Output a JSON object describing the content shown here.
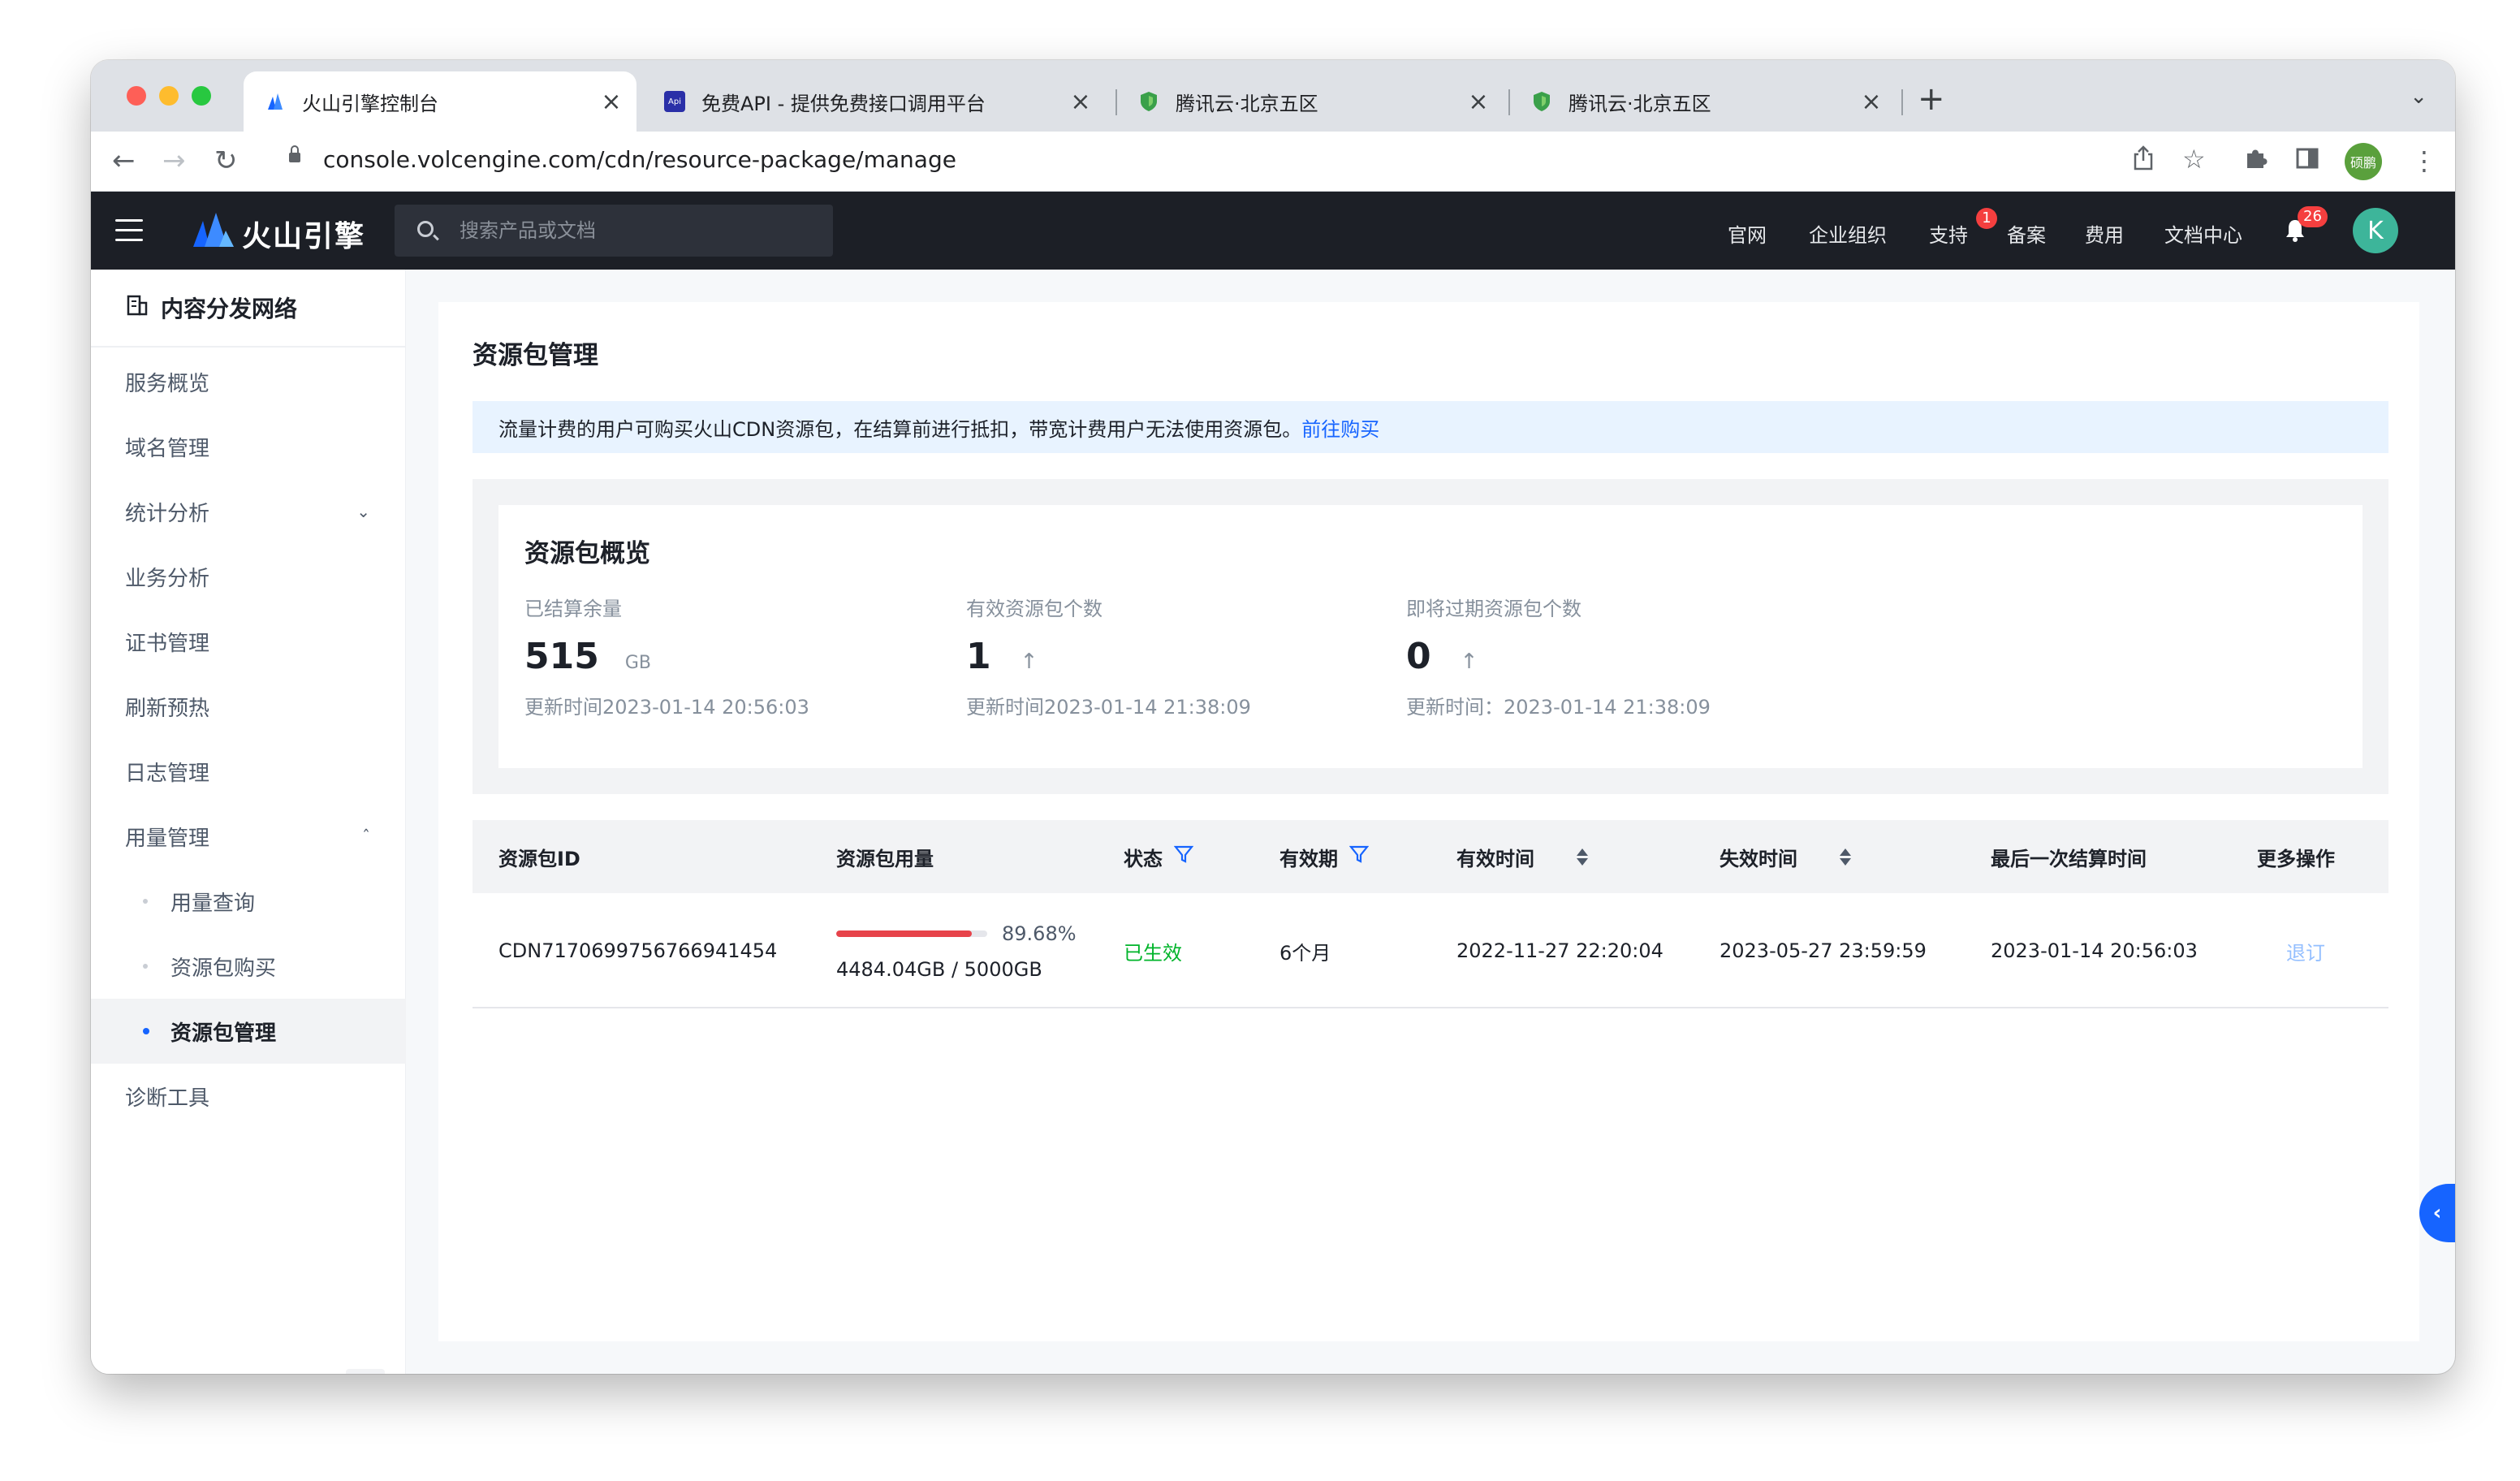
{
  "browser": {
    "tabs": [
      {
        "title": "火山引擎控制台",
        "active": true,
        "favicon": "volcengine-icon"
      },
      {
        "title": "免费API - 提供免费接口调用平台",
        "active": false,
        "favicon": "api-icon"
      },
      {
        "title": "腾讯云·北京五区",
        "active": false,
        "favicon": "shield-icon"
      },
      {
        "title": "腾讯云·北京五区",
        "active": false,
        "favicon": "shield-icon"
      }
    ],
    "api_favicon_text": "Api",
    "new_tab_label": "+",
    "url": "console.volcengine.com/cdn/resource-package/manage",
    "profile_initials": "硕鹏"
  },
  "header": {
    "brand": "火山引擎",
    "search_placeholder": "搜索产品或文档",
    "nav": [
      "官网",
      "企业组织",
      "支持",
      "备案",
      "费用",
      "文档中心"
    ],
    "support_badge": "1",
    "notification_count": "26",
    "avatar_letter": "K"
  },
  "sidebar": {
    "product": "内容分发网络",
    "items": [
      "服务概览",
      "域名管理",
      "统计分析",
      "业务分析",
      "证书管理",
      "刷新预热",
      "日志管理",
      "用量管理"
    ],
    "sub_items": [
      "用量查询",
      "资源包购买",
      "资源包管理"
    ],
    "last_item": "诊断工具",
    "active_sub": "资源包管理"
  },
  "page": {
    "title": "资源包管理",
    "alert_text": "流量计费的用户可购买火山CDN资源包，在结算前进行抵扣，带宽计费用户无法使用资源包。",
    "alert_link": "前往购买",
    "overview": {
      "title": "资源包概览",
      "stats": [
        {
          "label": "已结算余量",
          "value": "515",
          "unit": "GB",
          "time": "更新时间2023-01-14 20:56:03"
        },
        {
          "label": "有效资源包个数",
          "value": "1",
          "arrow": "↑",
          "time": "更新时间2023-01-14 21:38:09"
        },
        {
          "label": "即将过期资源包个数",
          "value": "0",
          "arrow": "↑",
          "time": "更新时间：2023-01-14 21:38:09"
        }
      ]
    },
    "table": {
      "columns": [
        "资源包ID",
        "资源包用量",
        "状态",
        "有效期",
        "有效时间",
        "失效时间",
        "最后一次结算时间",
        "更多操作"
      ],
      "rows": [
        {
          "id": "CDN7170699756766941454",
          "usage_percent": 89.68,
          "usage_percent_label": "89.68%",
          "usage_amount": "4484.04GB / 5000GB",
          "status": "已生效",
          "period": "6个月",
          "start": "2022-11-27 22:20:04",
          "end": "2023-05-27 23:59:59",
          "last_settle": "2023-01-14 20:56:03",
          "action": "退订"
        }
      ]
    }
  },
  "colors": {
    "accent": "#1664ff",
    "header_bg": "#1c1f26",
    "usage_bar": "#e7434a",
    "status_ok": "#00b42a",
    "alert_bg": "#e8f3ff"
  }
}
